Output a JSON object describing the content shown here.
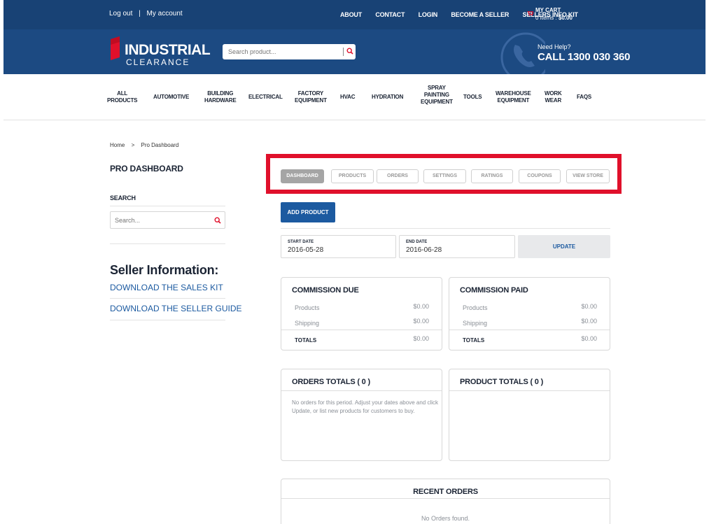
{
  "topbar": {
    "logout": "Log out",
    "separator": "|",
    "my_account": "My account",
    "nav": [
      "ABOUT",
      "CONTACT",
      "LOGIN",
      "BECOME A SELLER",
      "SELLERS INFO KIT"
    ],
    "cart_title": "MY CART",
    "cart_items": "0 Items : ",
    "cart_total": "$0.00"
  },
  "header": {
    "logo_line1": "INDUSTRIAL",
    "logo_line2": "CLEARANCE",
    "search_placeholder": "Search product...",
    "help_small": "Need Help?",
    "help_phone": "CALL 1300 030 360"
  },
  "categories": [
    [
      "ALL",
      "PRODUCTS"
    ],
    [
      "AUTOMOTIVE"
    ],
    [
      "BUILDING",
      "HARDWARE"
    ],
    [
      "ELECTRICAL"
    ],
    [
      "FACTORY",
      "EQUIPMENT"
    ],
    [
      "HVAC"
    ],
    [
      "HYDRATION"
    ],
    [
      "SPRAY",
      "PAINTING",
      "EQUIPMENT"
    ],
    [
      "TOOLS"
    ],
    [
      "WAREHOUSE",
      "EQUIPMENT"
    ],
    [
      "WORK",
      "WEAR"
    ],
    [
      "FAQS"
    ]
  ],
  "breadcrumb": {
    "home": "Home",
    "sep": ">",
    "current": "Pro Dashboard"
  },
  "sidebar": {
    "title": "PRO DASHBOARD",
    "search_label": "SEARCH",
    "search_placeholder": "Search...",
    "seller_info_title": "Seller Information:",
    "link_sales_kit": "DOWNLOAD THE SALES KIT",
    "link_seller_guide": "DOWNLOAD THE SELLER GUIDE"
  },
  "tabs": [
    "DASHBOARD",
    "PRODUCTS",
    "ORDERS",
    "SETTINGS",
    "RATINGS",
    "COUPONS",
    "VIEW STORE"
  ],
  "active_tab": "DASHBOARD",
  "dashboard": {
    "add_product": "ADD PRODUCT",
    "start_date_label": "START DATE",
    "start_date": "2016-05-28",
    "end_date_label": "END DATE",
    "end_date": "2016-06-28",
    "update": "UPDATE",
    "commission_due": {
      "title": "COMMISSION DUE",
      "products_label": "Products",
      "products_value": "$0.00",
      "shipping_label": "Shipping",
      "shipping_value": "$0.00",
      "totals_label": "TOTALS",
      "totals_value": "$0.00"
    },
    "commission_paid": {
      "title": "COMMISSION PAID",
      "products_label": "Products",
      "products_value": "$0.00",
      "shipping_label": "Shipping",
      "shipping_value": "$0.00",
      "totals_label": "TOTALS",
      "totals_value": "$0.00"
    },
    "orders_totals_title": "ORDERS TOTALS ( 0 )",
    "orders_empty": "No orders for this period. Adjust your dates above and click Update, or list new products for customers to buy.",
    "product_totals_title": "PRODUCT TOTALS ( 0 )",
    "recent_orders_title": "RECENT ORDERS",
    "recent_orders_empty": "No Orders found."
  },
  "colors": {
    "topbar": "#184275",
    "header": "#1c4a82",
    "accent_red": "#e0102b",
    "link_blue": "#1c5aa0"
  }
}
